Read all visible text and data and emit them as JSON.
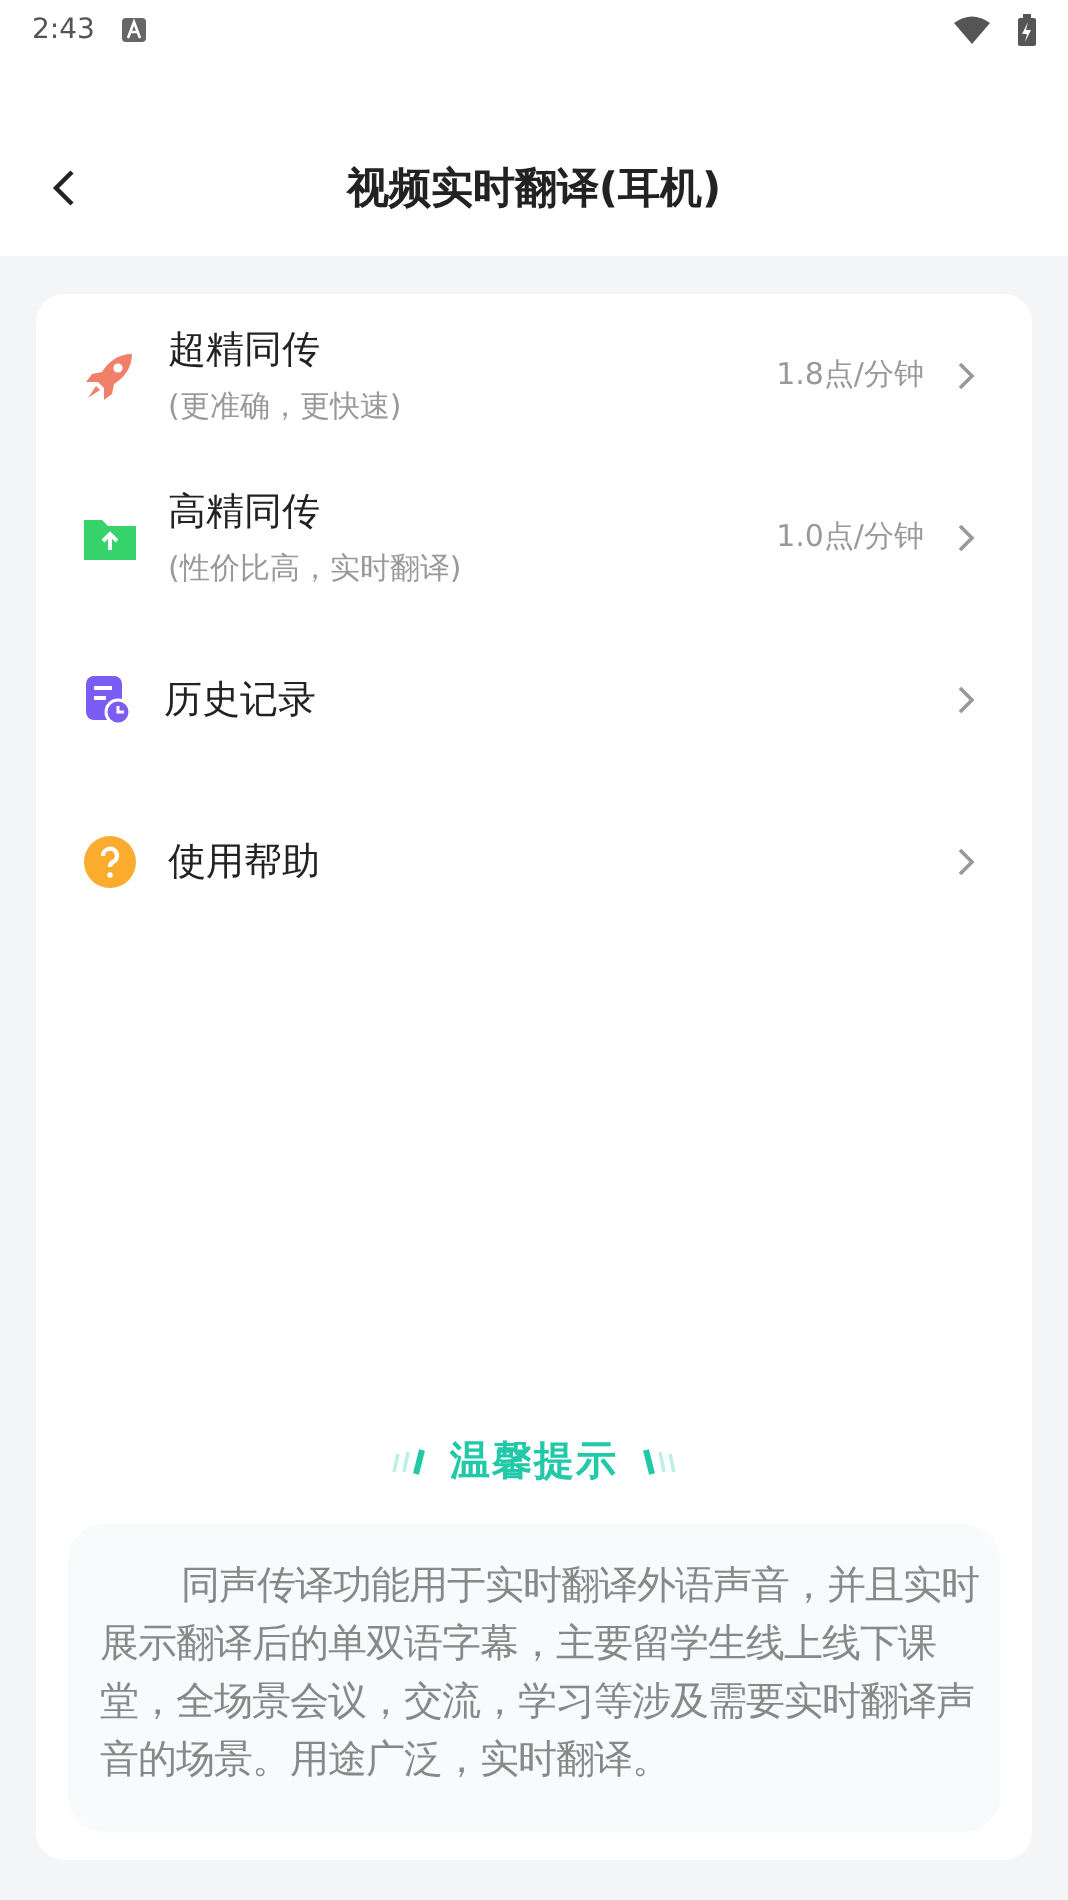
{
  "status_bar": {
    "time": "2:43"
  },
  "header": {
    "title": "视频实时翻译(耳机)"
  },
  "menu": [
    {
      "kind": "rocket",
      "title": "超精同传",
      "subtitle": "(更准确，更快速)",
      "price": "1.8点/分钟"
    },
    {
      "kind": "upload",
      "title": "高精同传",
      "subtitle": "(性价比高，实时翻译)",
      "price": "1.0点/分钟"
    },
    {
      "kind": "history",
      "title": "历史记录"
    },
    {
      "kind": "help",
      "title": "使用帮助"
    }
  ],
  "tip": {
    "title": "温馨提示",
    "text": "同声传译功能用于实时翻译外语声音，并且实时展示翻译后的单双语字幕，主要留学生线上线下课堂，全场景会议，交流，学习等涉及需要实时翻译声音的场景。用途广泛，实时翻译。"
  }
}
